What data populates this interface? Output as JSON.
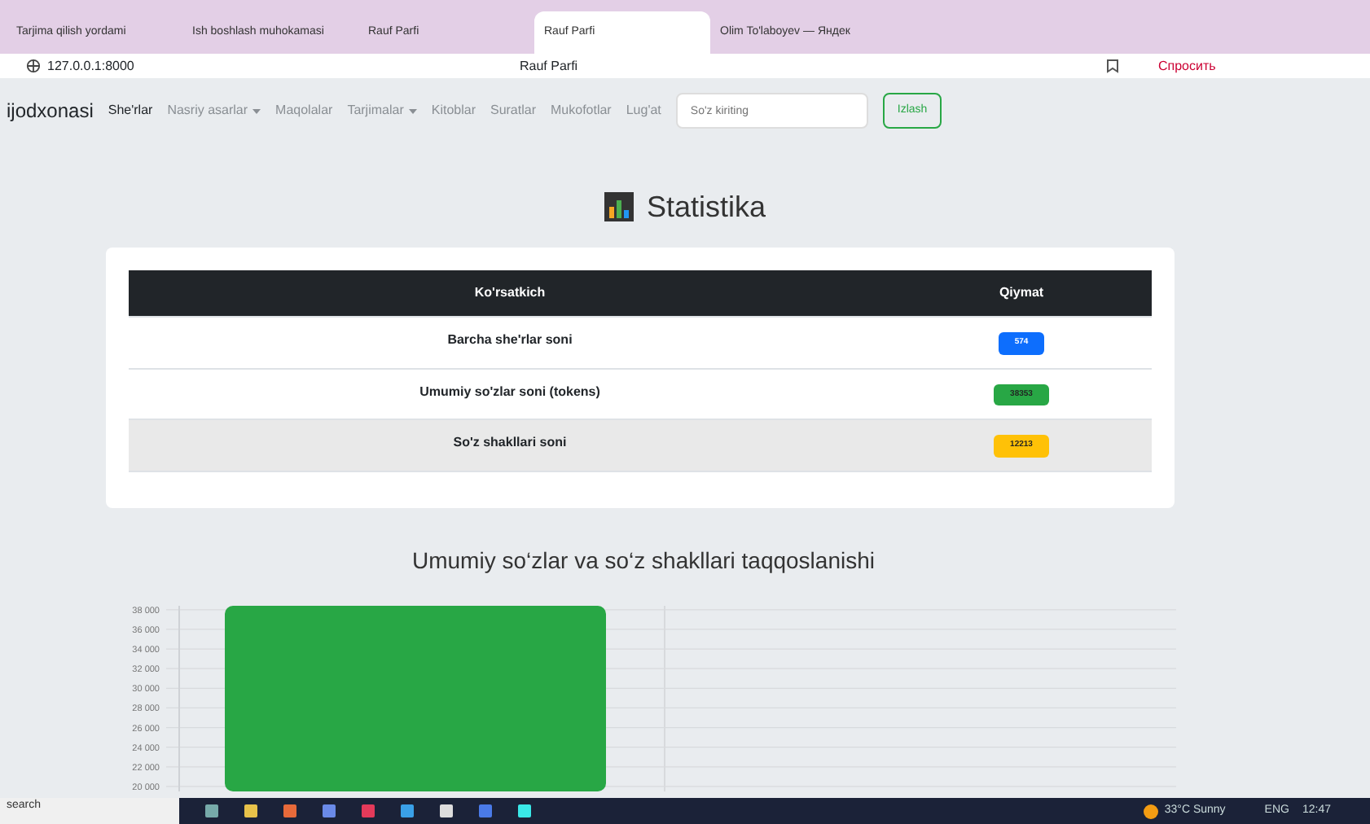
{
  "browser": {
    "tabs": [
      {
        "label": "Tarjima qilish yordami",
        "selected": false
      },
      {
        "label": "Ish boshlash muhokamasi",
        "selected": false
      },
      {
        "label": "Rauf Parfi",
        "selected": false
      },
      {
        "label": "Rauf Parfi",
        "selected": true
      },
      {
        "label": "Olim To'laboyev — Яндек",
        "selected": false
      }
    ],
    "address": "127.0.0.1:8000",
    "page_title": "Rauf Parfi",
    "ask_button": "Спросить"
  },
  "navbar": {
    "brand": "ijodxonasi",
    "items": [
      {
        "label": "She'rlar",
        "selected": true,
        "dropdown": false
      },
      {
        "label": "Nasriy asarlar",
        "selected": false,
        "dropdown": true
      },
      {
        "label": "Maqolalar",
        "selected": false,
        "dropdown": false
      },
      {
        "label": "Tarjimalar",
        "selected": false,
        "dropdown": true
      },
      {
        "label": "Kitoblar",
        "selected": false,
        "dropdown": false
      },
      {
        "label": "Suratlar",
        "selected": false,
        "dropdown": false
      },
      {
        "label": "Mukofotlar",
        "selected": false,
        "dropdown": false
      },
      {
        "label": "Lug'at",
        "selected": false,
        "dropdown": false
      }
    ],
    "search": {
      "placeholder": "So'z kiriting"
    },
    "search_button": "Izlash"
  },
  "heading": "Statistika",
  "table": {
    "columns": [
      "Ko'rsatkich",
      "Qiymat"
    ],
    "rows": [
      {
        "label": "Barcha she'rlar soni",
        "value": "574",
        "color": "#0d6efd"
      },
      {
        "label": "Umumiy so'zlar soni (tokens)",
        "value": "38353",
        "color": "#28a745"
      },
      {
        "label": "So'z shakllari soni",
        "value": "12213",
        "color": "#ffc107"
      }
    ]
  },
  "chart": {
    "chart_data": {
      "type": "bar",
      "title": "Umumiy so‘zlar va so‘z shakllari taqqoslanishi",
      "ylim": [
        19500,
        38400
      ],
      "grid": true,
      "yticks": [
        {
          "value": 38000,
          "label": "38 000"
        },
        {
          "value": 36000,
          "label": "36 000"
        },
        {
          "value": 34000,
          "label": "34 000"
        },
        {
          "value": 32000,
          "label": "32 000"
        },
        {
          "value": 30000,
          "label": "30 000"
        },
        {
          "value": 28000,
          "label": "28 000"
        },
        {
          "value": 26000,
          "label": "26 000"
        },
        {
          "value": 24000,
          "label": "24 000"
        },
        {
          "value": 22000,
          "label": "22 000"
        },
        {
          "value": 20000,
          "label": "20 000"
        }
      ],
      "series": [
        {
          "color": "#28a745",
          "values": [
            38400,
            null
          ]
        }
      ]
    }
  },
  "taskbar": {
    "search": "search",
    "weather": "33°C Sunny",
    "language": "ENG",
    "time": "12:47"
  }
}
